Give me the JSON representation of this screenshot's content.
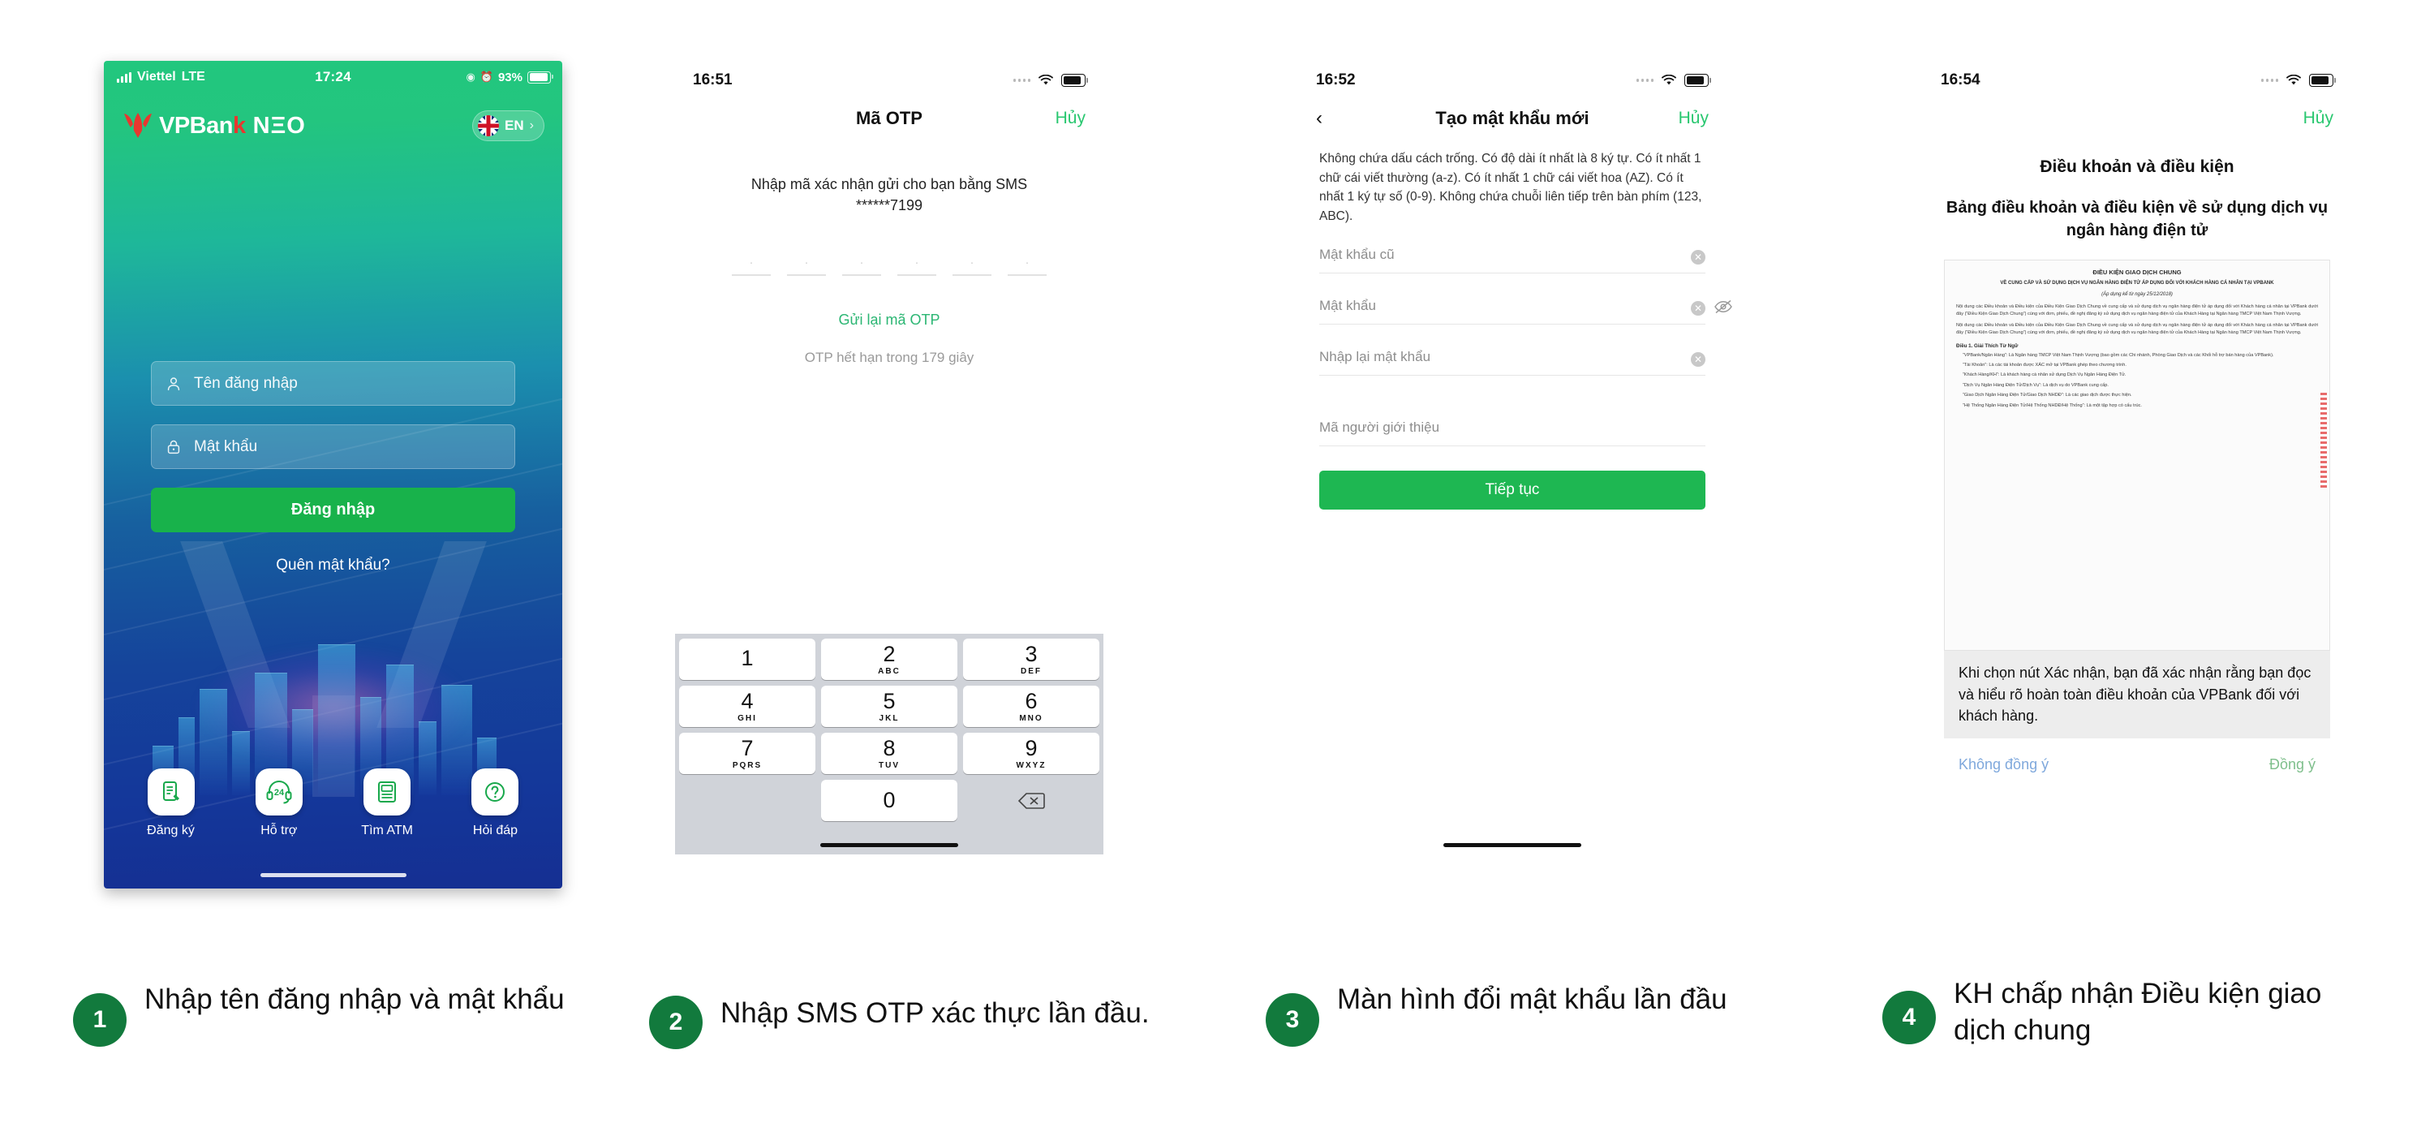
{
  "phone1": {
    "status": {
      "carrier": "Viettel",
      "network": "LTE",
      "time": "17:24",
      "battery": "93%"
    },
    "brand": {
      "name_vp": "VPBan",
      "name_k": "k",
      "name_neo": " NΞO",
      "full": "VPBank NΞO"
    },
    "language": {
      "code": "EN",
      "chevron": "›"
    },
    "fields": [
      {
        "name": "username",
        "placeholder": "Tên đăng nhập",
        "icon": "user-icon"
      },
      {
        "name": "password",
        "placeholder": "Mật khẩu",
        "icon": "lock-icon"
      }
    ],
    "login_button": "Đăng nhập",
    "forgot_password": "Quên mật khẩu?",
    "quicknav": [
      {
        "label": "Đăng ký",
        "icon": "register-form-icon"
      },
      {
        "label": "Hỗ trợ",
        "icon": "headset-24-icon"
      },
      {
        "label": "Tìm ATM",
        "icon": "atm-icon"
      },
      {
        "label": "Hỏi đáp",
        "icon": "faq-icon"
      }
    ]
  },
  "phone2": {
    "status": {
      "time": "16:51"
    },
    "nav": {
      "title": "Mã OTP",
      "cancel": "Hủy"
    },
    "subtitle_line1": "Nhập mã xác nhận gửi cho bạn bằng SMS",
    "subtitle_line2": "******7199",
    "otp_cells": [
      "·",
      "·",
      "·",
      "·",
      "·",
      "·"
    ],
    "resend": "Gửi lại mã OTP",
    "expire": "OTP hết hạn trong 179 giây",
    "keypad": [
      {
        "num": "1",
        "abc": ""
      },
      {
        "num": "2",
        "abc": "ABC"
      },
      {
        "num": "3",
        "abc": "DEF"
      },
      {
        "num": "4",
        "abc": "GHI"
      },
      {
        "num": "5",
        "abc": "JKL"
      },
      {
        "num": "6",
        "abc": "MNO"
      },
      {
        "num": "7",
        "abc": "PQRS"
      },
      {
        "num": "8",
        "abc": "TUV"
      },
      {
        "num": "9",
        "abc": "WXYZ"
      },
      {
        "num": "0",
        "abc": ""
      }
    ],
    "delete_icon": "backspace-icon"
  },
  "phone3": {
    "status": {
      "time": "16:52"
    },
    "nav": {
      "back": "‹",
      "title": "Tạo mật khẩu mới",
      "cancel": "Hủy"
    },
    "rules": "Không chứa dấu cách trống. Có độ dài ít nhất là 8 ký tự. Có ít nhất 1 chữ cái viết thường (a-z). Có ít nhất 1 chữ cái viết hoa (AZ). Có ít nhất 1 ký tự số (0-9). Không chứa chuỗi liên tiếp trên bàn phím (123, ABC).",
    "fields": [
      {
        "label": "Mật khẩu cũ",
        "clear": "✕"
      },
      {
        "label": "Mật khẩu",
        "clear": "✕"
      },
      {
        "label": "Nhập lại mật khẩu",
        "clear": "✕"
      },
      {
        "label": "Mã người giới thiệu",
        "clear": ""
      }
    ],
    "continue_button": "Tiếp tục"
  },
  "phone4": {
    "status": {
      "time": "16:54"
    },
    "nav": {
      "cancel": "Hủy"
    },
    "heading": "Điều khoản và điều kiện",
    "subheading": "Bảng điều khoản và điều kiện về sử dụng dịch vụ ngân hàng điện tử",
    "document": {
      "title": "ĐIỀU KIỆN GIAO DỊCH CHUNG",
      "subtitle": "VỀ CUNG CẤP VÀ SỬ DỤNG DỊCH VỤ NGÂN HÀNG ĐIỆN TỬ ÁP DỤNG ĐỐI VỚI KHÁCH HÀNG CÁ NHÂN TẠI VPBANK",
      "effective": "(Áp dụng kể từ ngày 25/12/2018)",
      "intro": "Nội dung các Điều khoản và Điều kiện của Điều Kiện Giao Dịch Chung về cung cấp và sử dụng dịch vụ ngân hàng điện tử áp dụng đối với Khách hàng cá nhân tại VPBank dưới đây (“Điều Kiện Giao Dịch Chung”) cùng với đơn, phiếu, đề nghị đăng ký sử dụng dịch vụ ngân hàng điện tử của Khách Hàng tại Ngân hàng TMCP Việt Nam Thịnh Vượng.",
      "section1": "Điều 1.    Giải Thích Từ Ngữ",
      "items": [
        "“VPBank/Ngân Hàng”: Là Ngân hàng TMCP Việt Nam Thịnh Vượng (bao gồm các Chi nhánh, Phòng Giao Dịch và các Khối hỗ trợ bán hàng của VPBank).",
        "“Tài Khoản”: Là các tài khoản được XÁC mở tại VPBank ghép theo chương trình.",
        "“Khách Hàng/KH”: Là khách hàng cá nhân sử dụng Dịch Vụ Ngân Hàng Điện Tử.",
        "“Dịch Vụ Ngân Hàng Điện Tử/Dịch Vụ”: Là dịch vụ do VPBank cung cấp.",
        "“Giao Dịch Ngân Hàng Điện Tử/Giao Dịch NHDĐ”: Là các giao dịch được thực hiện.",
        "“Hệ Thống Ngân Hàng Điện Tử/Hệ Thống NHDĐ/Hệ Thống”: Là một tập hợp có cấu trúc."
      ]
    },
    "note": "Khi chọn nút Xác nhận, bạn đã xác nhận rằng bạn đọc và hiểu rõ hoàn toàn điều khoản của VPBank đối với khách hàng.",
    "decline": "Không đồng ý",
    "accept": "Đồng ý"
  },
  "captions": [
    {
      "number": "1",
      "text": "Nhập tên đăng nhập và mật khẩu"
    },
    {
      "number": "2",
      "text": "Nhập SMS OTP xác thực lần đầu."
    },
    {
      "number": "3",
      "text": "Màn hình đổi mật khẩu lần đầu"
    },
    {
      "number": "4",
      "text": "KH chấp nhận Điều kiện giao dịch chung"
    }
  ],
  "colors": {
    "brand_green": "#18b24b",
    "accent_green": "#28c76f",
    "badge_green": "#127a3d",
    "logo_red": "#e8372f",
    "link_blue": "#7fa8dc"
  }
}
